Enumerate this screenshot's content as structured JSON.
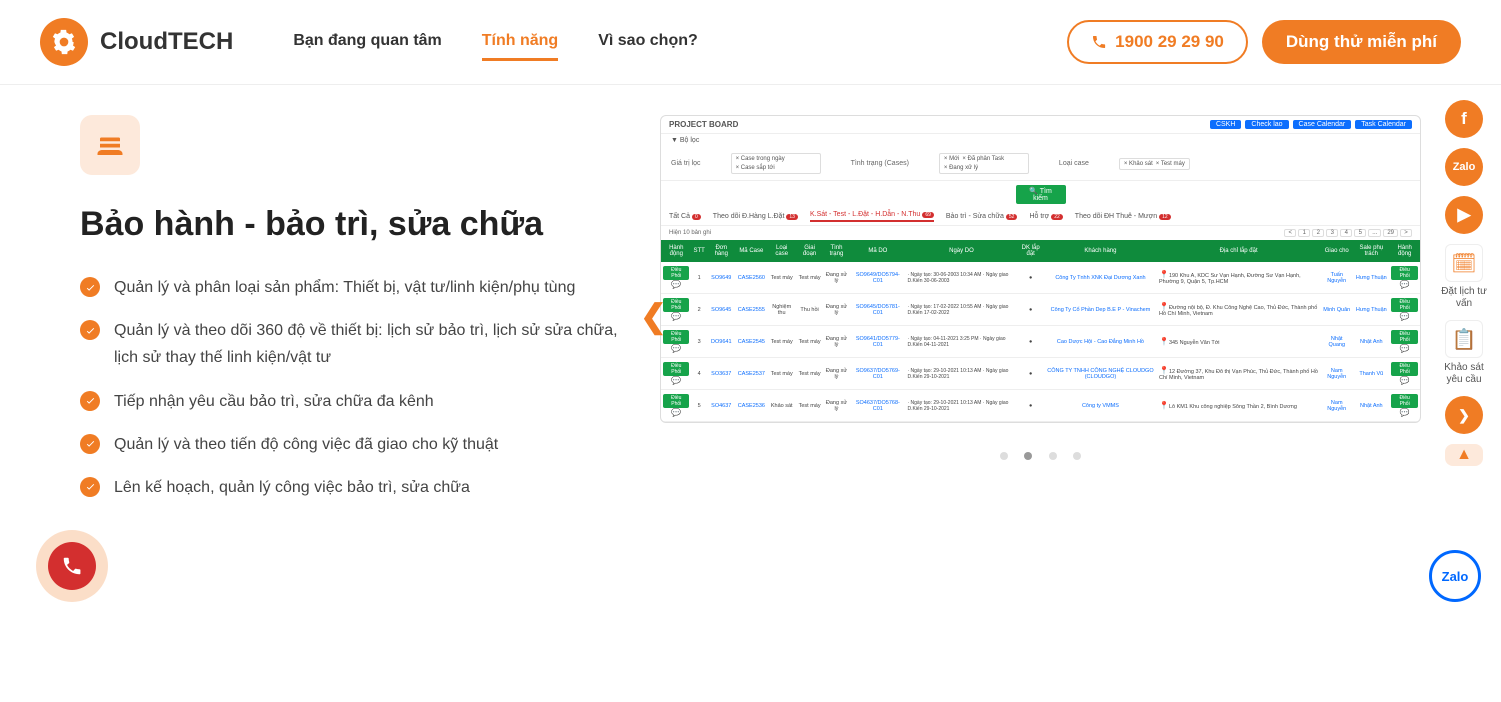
{
  "header": {
    "logo_text": "CloudTECH",
    "nav": [
      "Bạn đang quan tâm",
      "Tính năng",
      "Vì sao chọn?"
    ],
    "nav_active": 1,
    "phone": "1900 29 29 90",
    "cta": "Dùng thử miễn phí"
  },
  "feature": {
    "title": "Bảo hành - bảo trì, sửa chữa",
    "bullets": [
      "Quản lý và phân loại sản phẩm: Thiết bị, vật tư/linh kiện/phụ tùng",
      "Quản lý và theo dõi 360 độ về thiết bị: lịch sử bảo trì, lịch sử sửa chữa, lịch sử thay thế linh kiện/vật tư",
      "Tiếp nhận yêu cầu bảo trì, sửa chữa đa kênh",
      "Quản lý và theo tiến độ công việc đã giao cho kỹ thuật",
      "Lên kế hoạch, quản lý công việc bảo trì, sửa chữa"
    ]
  },
  "rail": {
    "schedule_label": "Đặt lịch tư vấn",
    "survey_label": "Khảo sát yêu cầu",
    "zalo_text": "Zalo"
  },
  "screenshot": {
    "project_board": "PROJECT BOARD",
    "top_buttons": [
      "CSKH",
      "Check lao",
      "Case Calendar",
      "Task Calendar"
    ],
    "filter_label": "▼ Bộ lọc",
    "filters": {
      "f1_label": "Giá trị lọc",
      "f1_tags": [
        "× Case trong ngày",
        "× Case sắp tới"
      ],
      "f2_label": "Tình trạng (Cases)",
      "f3_tags": [
        "× Mới",
        "× Đã phân Task",
        "× Đang xử lý"
      ],
      "f4_label": "Loại case",
      "f5_tags": [
        "× Khảo sát",
        "× Test máy"
      ]
    },
    "search_btn": "🔍 Tìm kiếm",
    "tabs": [
      {
        "label": "Tất Cả",
        "badge": "0"
      },
      {
        "label": "Theo dõi Đ.Hàng L.Đặt",
        "badge": "13"
      },
      {
        "label": "K.Sát - Test - L.Đặt - H.Dẫn - N.Thu",
        "badge": "69",
        "active": true
      },
      {
        "label": "Bảo trì - Sửa chữa",
        "badge": "52"
      },
      {
        "label": "Hỗ trợ",
        "badge": "22"
      },
      {
        "label": "Theo dõi ĐH Thuê - Mượn",
        "badge": "12"
      }
    ],
    "paging_label": "Hiện 10 bản ghi",
    "pages": [
      "<",
      "1",
      "2",
      "3",
      "4",
      "5",
      "...",
      "29",
      ">"
    ],
    "columns": [
      "Hành động",
      "STT",
      "Đơn hàng",
      "Mã Case",
      "Loại case",
      "Giai đoạn",
      "Tình trạng",
      "Mã DO",
      "Ngày DO",
      "DK lắp đặt",
      "Khách hàng",
      "Địa chỉ lắp đặt",
      "Giao cho",
      "Sale phụ trách",
      "Hành động"
    ],
    "rows": [
      {
        "stt": "1",
        "don": "SO9649",
        "case": "CASE2560",
        "loai": "Test máy",
        "giai": "Test máy",
        "tinh": "Đang xử lý",
        "mado": "SO9649/DO5794-C01",
        "ngay": "Ngày tạo: 30-06-2003 10:34 AM · Ngày giao D.Kiến 30-06-2003",
        "kh": "Công Ty Tnhh XNK Đại Dương Xanh",
        "dc": "190 Khu A, KDC Sư Vạn Hạnh, Đường Sư Vạn Hạnh, Phường 9, Quận 5, Tp.HCM",
        "gc": "Tuấn Nguyễn",
        "sale": "Hưng Thuận"
      },
      {
        "stt": "2",
        "don": "SO9645",
        "case": "CASE2555",
        "loai": "Nghiệm thu",
        "giai": "Thu hồi",
        "tinh": "Đang xử lý",
        "mado": "SO9645/DO5781-C01",
        "ngay": "Ngày tạo: 17-02-2022 10:55 AM · Ngày giao D.Kiến 17-02-2022",
        "kh": "Công Ty Cổ Phần Dep B.E P - Vinachem",
        "dc": "Đường nội bộ, Đ. Khu Công Nghệ Cao, Thủ Đức, Thành phố Hồ Chí Minh, Vietnam",
        "gc": "Minh Quân",
        "sale": "Hưng Thuận"
      },
      {
        "stt": "3",
        "don": "DO9641",
        "case": "CASE2545",
        "loai": "Test máy",
        "giai": "Test máy",
        "tinh": "Đang xử lý",
        "mado": "SO9641/DO5779-C01",
        "ngay": "Ngày tạo: 04-11-2021 3:25 PM · Ngày giao D.Kiến 04-11-2021",
        "kh": "Cao Dược Hội - Cao Đẳng Minh Hồ",
        "dc": "345 Nguyễn Văn Tới",
        "gc": "Nhật Quang",
        "sale": "Nhật Anh"
      },
      {
        "stt": "4",
        "don": "SO3637",
        "case": "CASE2537",
        "loai": "Test máy",
        "giai": "Test máy",
        "tinh": "Đang xử lý",
        "mado": "SO9637/DO5769-C01",
        "ngay": "Ngày tạo: 29-10-2021 10:13 AM · Ngày giao D.Kiến 29-10-2021",
        "kh": "CÔNG TY TNHH CÔNG NGHỆ CLOUDGO (CLOUDGO)",
        "dc": "12 Đường 37, Khu Đô thị Vạn Phúc, Thủ Đức, Thành phố Hồ Chí Minh, Vietnam",
        "gc": "Nam Nguyễn",
        "sale": "Thanh Vũ"
      },
      {
        "stt": "5",
        "don": "SO4637",
        "case": "CASE2536",
        "loai": "Khảo sát",
        "giai": "Test máy",
        "tinh": "Đang xử lý",
        "mado": "SO4637/DO5768-C01",
        "ngay": "Ngày tạo: 29-10-2021 10:13 AM · Ngày giao D.Kiến 29-10-2021",
        "kh": "Công ty VMMS",
        "dc": "Lô KM1 Khu công nghiệp Sông Thần 2, Bình Dương",
        "gc": "Nam Nguyễn",
        "sale": "Nhật Anh"
      }
    ],
    "action_label": "Điều Phối"
  },
  "slide_active": 1,
  "zalo_float": "Zalo"
}
